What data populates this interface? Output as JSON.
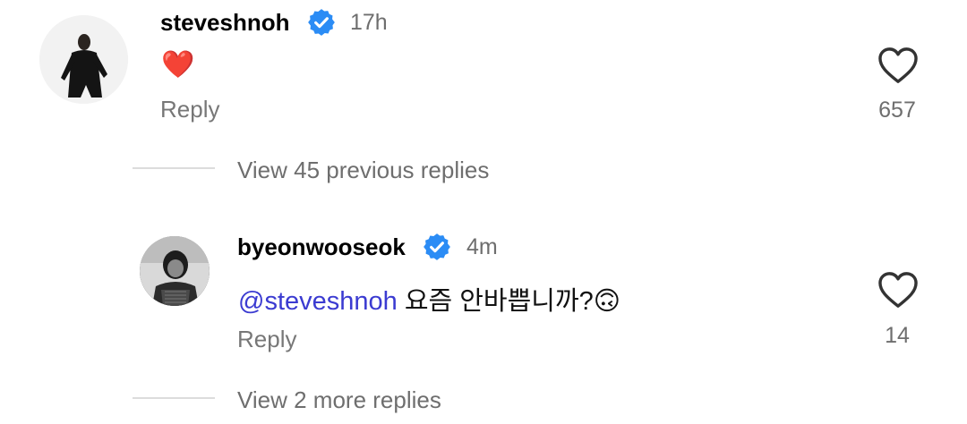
{
  "comment1": {
    "username": "steveshnoh",
    "time": "17h",
    "emoji": "❤️",
    "reply_label": "Reply",
    "likes": "657",
    "verified_color": "#2b8cf5"
  },
  "view_previous": "View 45 previous replies",
  "comment2": {
    "username": "byeonwooseok",
    "time": "4m",
    "mention": "@steveshnoh",
    "text": " 요즘 안바쁩니까?",
    "emoji": "🙃",
    "reply_label": "Reply",
    "likes": "14"
  },
  "view_more": "View 2 more replies"
}
